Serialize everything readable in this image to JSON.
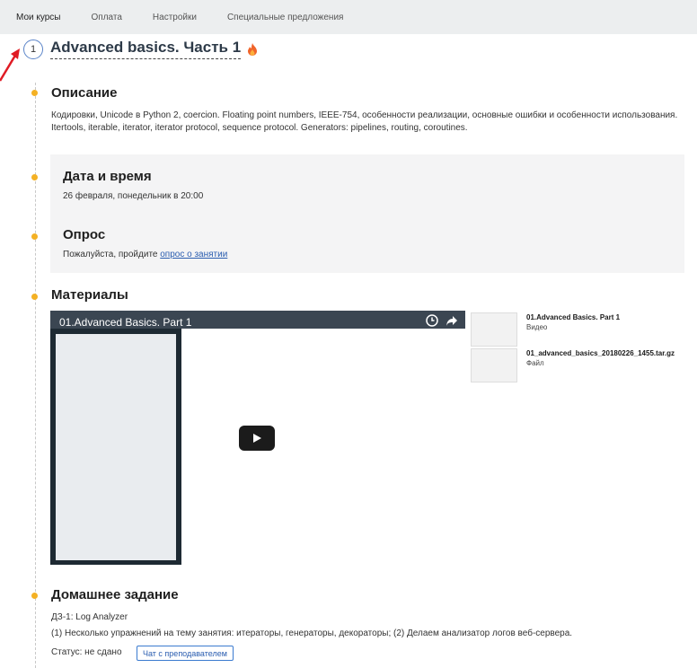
{
  "nav": {
    "items": [
      "Мои курсы",
      "Оплата",
      "Настройки",
      "Специальные предложения"
    ]
  },
  "lesson": {
    "number": "1",
    "title": "Advanced basics. Часть 1"
  },
  "description": {
    "title": "Описание",
    "text": "Кодировки, Unicode в Python 2, coercion. Floating point numbers, IEEE-754, особенности реализации, основные ошибки и особенности использования. Itertools, iterable, iterator, iterator protocol, sequence protocol. Generators: pipelines, routing, coroutines."
  },
  "datetime": {
    "title": "Дата и время",
    "value": "26 февраля, понедельник в 20:00"
  },
  "survey": {
    "title": "Опрос",
    "text_prefix": "Пожалуйста, пройдите ",
    "link": "опрос о занятии"
  },
  "materials": {
    "title": "Материалы",
    "video_title": "01.Advanced Basics. Part 1",
    "files": [
      {
        "name": "01.Advanced Basics. Part 1",
        "type": "Видео"
      },
      {
        "name": "01_advanced_basics_20180226_1455.tar.gz",
        "type": "Файл"
      }
    ]
  },
  "homework": {
    "title": "Домашнее задание",
    "name": "ДЗ-1: Log Analyzer",
    "text": "(1) Несколько упражнений на тему занятия: итераторы, генераторы, декораторы; (2) Делаем анализатор логов веб-сервера.",
    "status": "Статус: не сдано",
    "chat_button": "Чат с преподавателем"
  },
  "colors": {
    "accent": "#f4b124",
    "nav_bg": "#eceeef",
    "link": "#2a5db0",
    "arrow": "#e01b24"
  }
}
